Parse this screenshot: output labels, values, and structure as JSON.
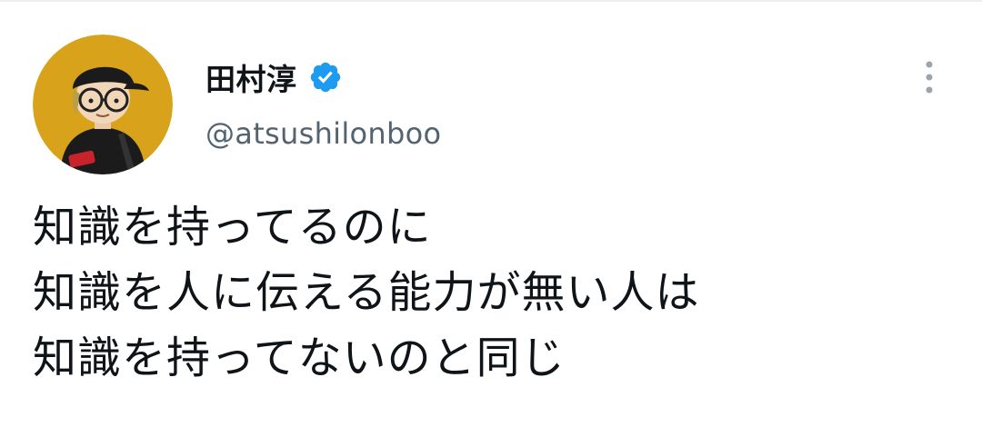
{
  "tweet": {
    "author": {
      "display_name": "田村淳",
      "handle": "@atsushilonboo",
      "verified": true,
      "avatar_icon": "user-avatar-illustration",
      "avatar_bg_color": "#d9a21b"
    },
    "text_lines": [
      "知識を持ってるのに",
      "知識を人に伝える能力が無い人は",
      "知識を持ってないのと同じ"
    ],
    "more_icon": "more-vertical-icon",
    "verified_icon": "verified-badge-icon",
    "colors": {
      "verified_blue": "#1d9bf0",
      "handle_gray": "#536471",
      "text": "#0f1419",
      "more_gray": "#9aa5ae"
    }
  }
}
